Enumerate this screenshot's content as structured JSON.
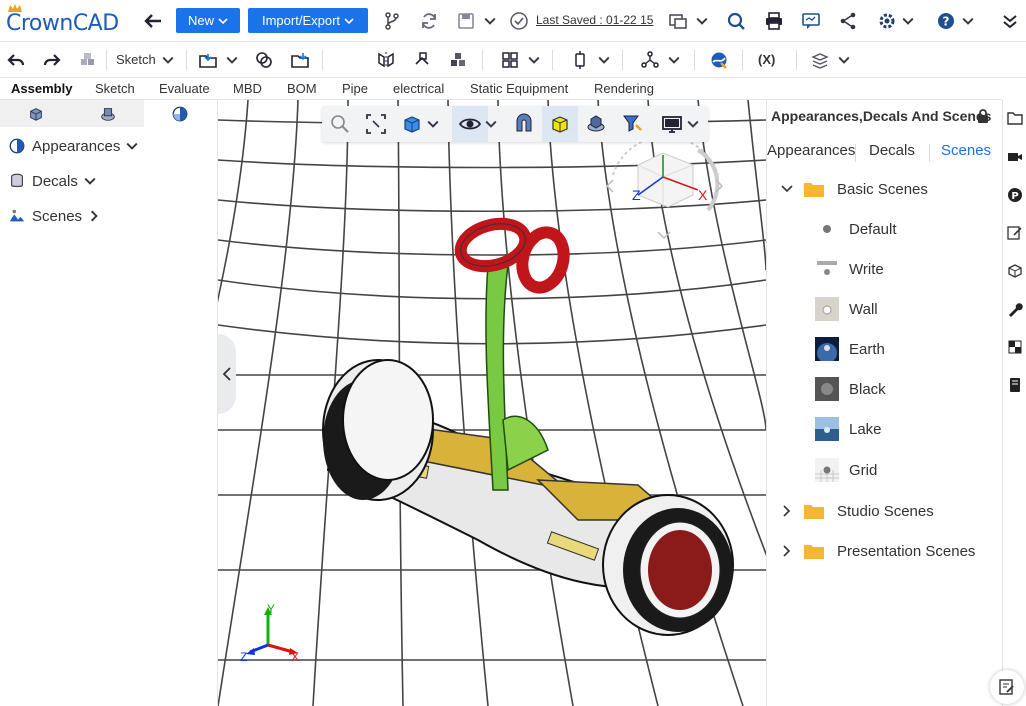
{
  "app": {
    "name": "CrownCAD"
  },
  "topbar": {
    "new_label": "New",
    "import_export_label": "Import/Export",
    "last_saved": "Last Saved : 01-22 15"
  },
  "toolbar2": {
    "sketch_label": "Sketch",
    "variables_label": "(X)"
  },
  "tabs": [
    "Assembly",
    "Sketch",
    "Evaluate",
    "MBD",
    "BOM",
    "Pipe",
    "electrical",
    "Static Equipment",
    "Rendering"
  ],
  "left_panel": {
    "items": [
      {
        "label": "Appearances",
        "icon": "appearance-sphere-icon",
        "expander": "chevron-down"
      },
      {
        "label": "Decals",
        "icon": "decal-cylinder-icon",
        "expander": "chevron-down"
      },
      {
        "label": "Scenes",
        "icon": "scene-icon",
        "expander": "chevron-right"
      }
    ]
  },
  "view_cube": {
    "axis_x": "X",
    "axis_z": "Z"
  },
  "triad": {
    "x": "X",
    "y": "Y",
    "z": "Z"
  },
  "right_panel": {
    "title": "Appearances,Decals And Scenes",
    "tabs": [
      "Appearances",
      "Decals",
      "Scenes"
    ],
    "active_tab": "Scenes",
    "basic_folder": "Basic Scenes",
    "scenes": [
      "Default",
      "Write",
      "Wall",
      "Earth",
      "Black",
      "Lake",
      "Grid"
    ],
    "studio_folder": "Studio Scenes",
    "presentation_folder": "Presentation Scenes"
  },
  "colors": {
    "accent": "#1a73e8",
    "folder": "#f5b731"
  }
}
